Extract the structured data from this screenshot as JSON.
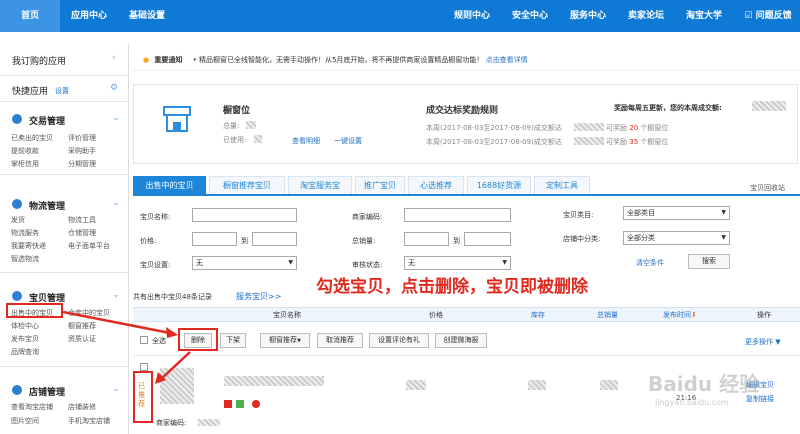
{
  "topbar": {
    "home": "首页",
    "app_center": "应用中心",
    "basic_settings": "基础设置",
    "rules_center": "规则中心",
    "security_center": "安全中心",
    "service_center": "服务中心",
    "seller_forum": "卖家论坛",
    "taobao_university": "淘宝大学",
    "feedback": "问题反馈"
  },
  "sidebar": {
    "my_apps": "我订购的应用",
    "quick_apps": "快捷应用",
    "quick_settings": "设置",
    "trade_title": "交易管理",
    "trade_items": [
      "已卖出的宝贝",
      "评价管理",
      "提前收款",
      "采购助手",
      "掌柜信用",
      "分期管理"
    ],
    "logistics_title": "物流管理",
    "logistics_items": [
      "发货",
      "物流工具",
      "物流服务",
      "仓储管理",
      "我要寄快递",
      "电子面单平台",
      "智选物流"
    ],
    "goods_title": "宝贝管理",
    "goods_items": [
      "出售中的宝贝",
      "仓库中的宝贝",
      "体检中心",
      "橱窗推荐",
      "发布宝贝",
      "资质认证",
      "品牌查询"
    ],
    "shop_title": "店铺管理",
    "shop_items": [
      "查看淘宝店铺",
      "店铺装修",
      "图片空间",
      "手机淘宝店铺"
    ]
  },
  "notice": {
    "tag": "重要通知",
    "text": "精品橱窗已全线智能化，无需手动操作！从5月底开始，将不再提供商家设置精品橱窗功能！",
    "link": "点击查看详情"
  },
  "window_card": {
    "title": "橱窗位",
    "total_label": "总量:",
    "used_label": "已使用:",
    "view_detail": "查看明细",
    "set_one": "一键设置",
    "rules_title": "成交达标奖励规则",
    "reward_title": "奖励每周五更新，您的本周成交额:",
    "week_line_1": "本周(2017-08-03至2017-08-09)成交额达",
    "week_line_2": "本周(2017-08-03至2017-08-09)成交额达",
    "reward_1_pre": "可奖励",
    "reward_1_num": "20",
    "reward_1_post": "个橱窗位",
    "reward_2_pre": "可奖励",
    "reward_2_num": "35",
    "reward_2_post": "个橱窗位"
  },
  "tabs": [
    "出售中的宝贝",
    "橱窗推荐宝贝",
    "淘宝服务宝",
    "推广宝贝",
    "心选推荐",
    "1688好货源",
    "定制工具"
  ],
  "recycle_bin": "宝贝回收站",
  "filters": {
    "name_label": "宝贝名称:",
    "code_label": "商家编码:",
    "category_label": "宝贝类目:",
    "category_value": "全部类目",
    "price_label": "价格:",
    "to1": "到",
    "sales_label": "总销量:",
    "to2": "到",
    "shop_cat_label": "店铺中分类:",
    "shop_cat_value": "全部分类",
    "setting_label": "宝贝设置:",
    "setting_value": "无",
    "audit_label": "审核状态:",
    "audit_value": "无",
    "clear": "清空条件",
    "search": "搜索"
  },
  "record_count": "共有出售中宝贝48条记录",
  "service_link": "服务宝贝>>",
  "annotation": "勾选宝贝，点击删除，宝贝即被删除",
  "table": {
    "columns": [
      "宝贝名称",
      "价格",
      "库存",
      "总销量",
      "发布时间",
      "操作"
    ]
  },
  "actions": {
    "select_all": "全选",
    "delete": "删除",
    "off_shelf": "下架",
    "window_recommend": "橱窗推荐",
    "cancel_recommend": "取消推荐",
    "set_review_gift": "设置评论有礼",
    "create_weitao": "创建微海报",
    "more_actions": "更多操作"
  },
  "row": {
    "status": "已推荐",
    "time": "21:16",
    "edit": "编辑宝贝",
    "copy_link": "复制链接",
    "merchant_code": "商家编码:"
  },
  "watermark": "Baidu 经验",
  "watermark_url": "jingyan.baidu.com"
}
